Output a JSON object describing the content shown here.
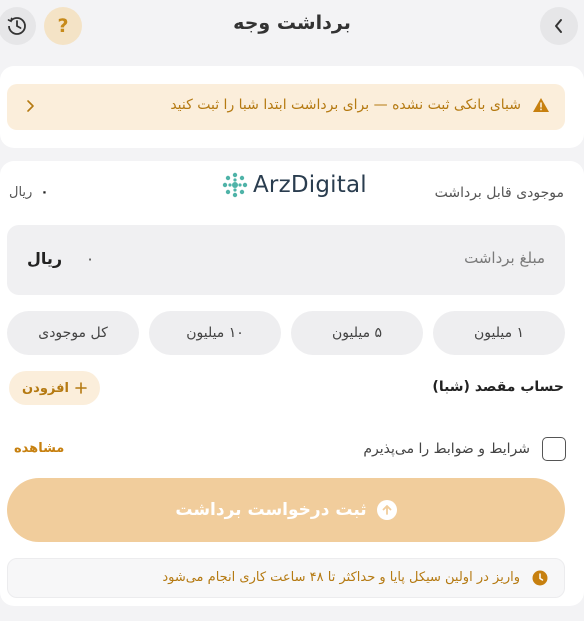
{
  "header": {
    "title": "برداشت وجه",
    "help_label": "?",
    "back_icon": "chevron-right-icon",
    "history_icon": "history-clock-icon"
  },
  "warning": {
    "text": "شبای بانکی ثبت نشده — برای برداشت ابتدا شبا را ثبت کنید",
    "icon": "warning-triangle-icon"
  },
  "balance": {
    "label": "موجودی قابل برداشت",
    "value": "۰",
    "unit": "ریال"
  },
  "logo": {
    "text": "ArzDigital"
  },
  "amount": {
    "label": "مبلغ برداشت",
    "value": "۰",
    "unit": "ریال"
  },
  "chips": [
    {
      "label": "۱ میلیون"
    },
    {
      "label": "۵ میلیون"
    },
    {
      "label": "۱۰ میلیون"
    },
    {
      "label": "کل موجودی"
    }
  ],
  "destination": {
    "label": "حساب مقصد (شبا)",
    "add_label": "افزودن"
  },
  "terms": {
    "text": "شرایط و ضوابط را می‌پذیرم",
    "view_label": "مشاهده",
    "checked": false
  },
  "submit": {
    "label": "ثبت درخواست برداشت"
  },
  "note": {
    "text": "واریز در اولین سیکل پایا و حداکثر تا ۴۸ ساعت کاری انجام می‌شود",
    "icon": "clock-icon"
  },
  "colors": {
    "accent": "#c7800f",
    "accent_light": "#fbeedb",
    "button_disabled": "#f1cd9c",
    "background": "#f3f3f5"
  }
}
